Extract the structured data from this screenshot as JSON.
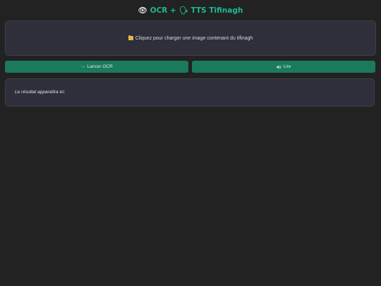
{
  "header": {
    "eye_icon": "eye-icon",
    "title_ocr": "OCR + ",
    "speaker_icon": "speaking-head-icon",
    "title_tts": "TTS Tifinagh",
    "accent_color": "#1fb894"
  },
  "upload": {
    "icon": "folder-icon",
    "label": "Cliquez pour charger une image contenant du tifinagh"
  },
  "actions": {
    "ocr_icon": "arrow-right-icon",
    "ocr_label": "Lancer OCR",
    "read_icon": "speaker-icon",
    "read_label": "Lire",
    "button_color": "#1b7a5e"
  },
  "result": {
    "text": "Le résultat apparaîtra ici."
  }
}
